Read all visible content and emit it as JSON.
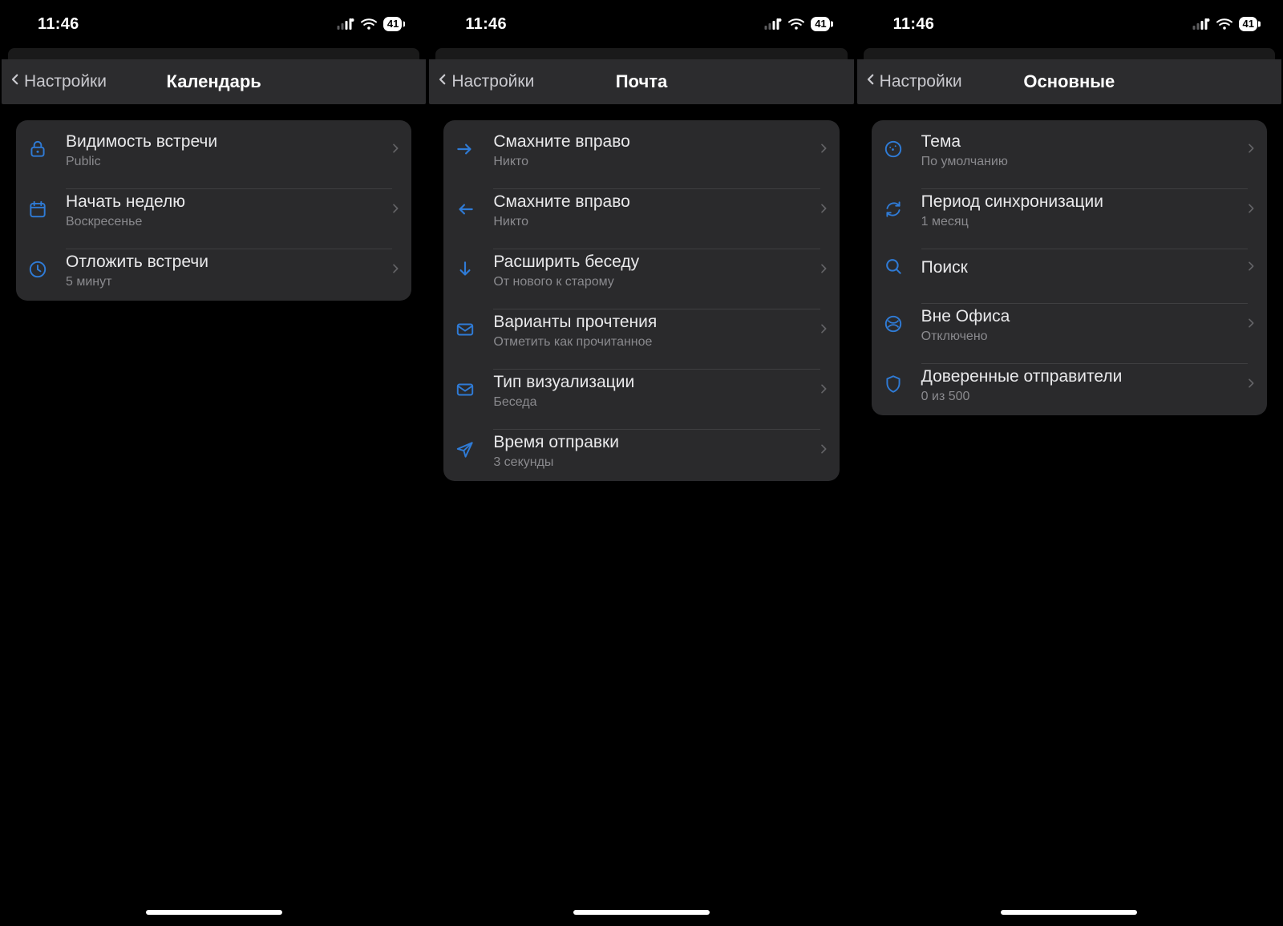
{
  "status": {
    "time": "11:46",
    "battery": "41"
  },
  "screens": [
    {
      "back": "Настройки",
      "title": "Календарь",
      "rows": [
        {
          "icon": "lock",
          "title": "Видимость встречи",
          "sub": "Public"
        },
        {
          "icon": "calendar",
          "title": "Начать неделю",
          "sub": "Воскресенье"
        },
        {
          "icon": "clock",
          "title": "Отложить встречи",
          "sub": "5 минут"
        }
      ]
    },
    {
      "back": "Настройки",
      "title": "Почта",
      "rows": [
        {
          "icon": "arrow-right",
          "title": "Смахните вправо",
          "sub": "Никто"
        },
        {
          "icon": "arrow-left",
          "title": "Смахните вправо",
          "sub": "Никто"
        },
        {
          "icon": "arrow-down",
          "title": "Расширить беседу",
          "sub": "От нового к старому"
        },
        {
          "icon": "mail",
          "title": "Варианты прочтения",
          "sub": "Отметить как прочитанное"
        },
        {
          "icon": "mail",
          "title": "Тип визуализации",
          "sub": "Беседа"
        },
        {
          "icon": "send",
          "title": "Время отправки",
          "sub": "3 секунды"
        }
      ]
    },
    {
      "back": "Настройки",
      "title": "Основные",
      "rows": [
        {
          "icon": "palette",
          "title": "Тема",
          "sub": "По умолчанию"
        },
        {
          "icon": "sync",
          "title": "Период синхронизации",
          "sub": "1 месяц"
        },
        {
          "icon": "search",
          "title": "Поиск"
        },
        {
          "icon": "globe",
          "title": "Вне Офиса",
          "sub": "Отключено"
        },
        {
          "icon": "shield",
          "title": "Доверенные отправители",
          "sub": "0 из 500"
        }
      ]
    }
  ]
}
